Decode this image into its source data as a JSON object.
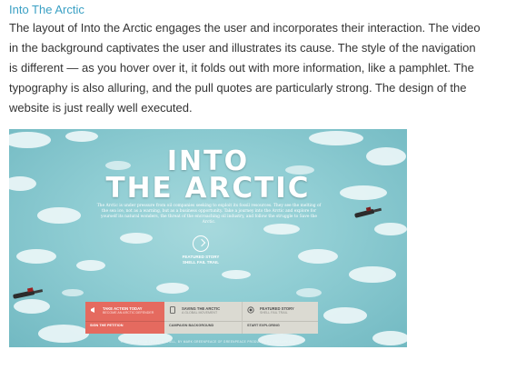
{
  "post": {
    "title": "Into The Arctic",
    "body": "The layout of Into the Arctic engages the user and incorporates their interaction. The video in the background captivates the user and illustrates its cause. The style of the navigation is different — as you hover over it, it folds out with more information, like a pamphlet. The typography is also alluring, and the pull quotes are particularly strong. The design of the website is just really well executed."
  },
  "screenshot": {
    "hero_line1": "INTO",
    "hero_line2": "THE ARCTIC",
    "hero_copy": "The Arctic is under pressure from oil companies seeking to exploit its fossil resources. They see the melting of the sea ice, not as a warning, but as a business opportunity. Take a journey into the Arctic and explore for yourself its natural wonders, the threat of the encroaching oil industry, and follow the struggle to Save the Arctic.",
    "play_icon": "play-circle",
    "featured_line1": "FEATURED STORY",
    "featured_line2": "SHELL FAIL TRAIL",
    "nav": [
      {
        "icon": "megaphone",
        "title": "TAKE ACTION TODAY",
        "subtitle": "BECOME AN ARCTIC DEFENDER",
        "action": "SIGN THE PETITION",
        "color": "#e56a5f"
      },
      {
        "icon": "tablet",
        "title": "SAVING THE ARCTIC",
        "subtitle": "A GLOBAL MOVEMENT",
        "action": "CAMPAIGN BACKGROUND",
        "color": "#dbdad2"
      },
      {
        "icon": "badge",
        "title": "FEATURED STORY",
        "subtitle": "SHELL FAIL TRAIL",
        "action": "START EXPLORING",
        "color": "#dbdad2"
      }
    ],
    "footer": "© IMAGES FROM THE FILM SHELL, BY MARK GREENPEACE OF GREENPEACE PRODUCED BY GREENPEACE"
  }
}
